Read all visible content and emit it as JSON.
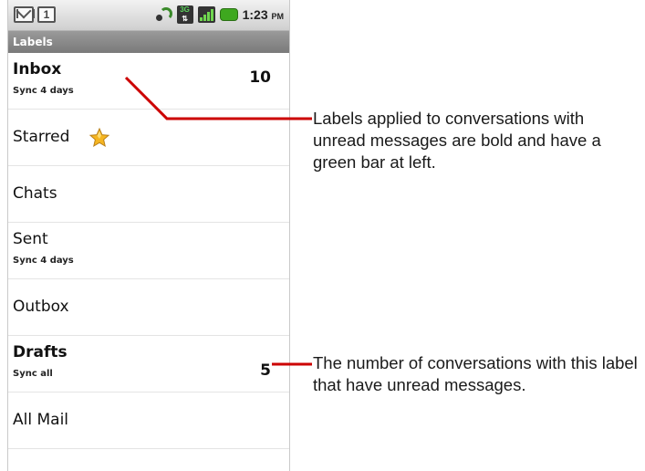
{
  "status_bar": {
    "calendar_day": "1",
    "network": "3G",
    "time": "1:23",
    "ampm": "PM"
  },
  "title": "Labels",
  "labels": [
    {
      "name": "Inbox",
      "sync": "Sync 4 days",
      "count": "10",
      "unread": true
    },
    {
      "name": "Starred",
      "sync": "",
      "count": "",
      "unread": false,
      "icon": "star-icon"
    },
    {
      "name": "Chats",
      "sync": "",
      "count": "",
      "unread": false
    },
    {
      "name": "Sent",
      "sync": "Sync 4 days",
      "count": "",
      "unread": false
    },
    {
      "name": "Outbox",
      "sync": "",
      "count": "",
      "unread": false
    },
    {
      "name": "Drafts",
      "sync": "Sync all",
      "count": "5",
      "unread": true
    },
    {
      "name": "All Mail",
      "sync": "",
      "count": "",
      "unread": false
    }
  ],
  "annotations": {
    "unread_labels": "Labels applied to conversations with unread messages are bold and have a green bar at left.",
    "unread_count": "The number of conversations with this label that have unread messages."
  },
  "colors": {
    "callout_line": "#cc0000",
    "title_bar": "#888888",
    "battery": "#3ea81f"
  }
}
